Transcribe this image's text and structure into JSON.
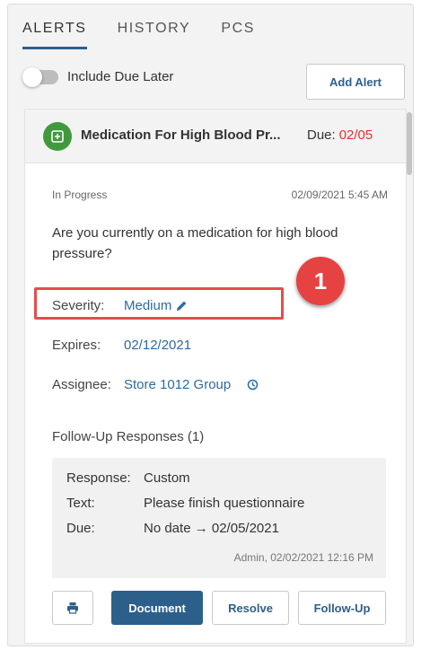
{
  "tabs": [
    {
      "label": "ALERTS",
      "active": true
    },
    {
      "label": "HISTORY",
      "active": false
    },
    {
      "label": "PCS",
      "active": false
    }
  ],
  "controls": {
    "toggle_label": "Include Due Later",
    "toggle_on": false,
    "add_alert_label": "Add Alert"
  },
  "alert": {
    "icon": "medication-icon",
    "title": "Medication For High Blood Pr...",
    "due_label": "Due:",
    "due_date": "02/05",
    "status": "In Progress",
    "timestamp": "02/09/2021 5:45 AM",
    "question": "Are you currently on a medication for high blood pressure?",
    "severity_label": "Severity:",
    "severity_value": "Medium",
    "expires_label": "Expires:",
    "expires_value": "02/12/2021",
    "assignee_label": "Assignee:",
    "assignee_value": "Store 1012 Group"
  },
  "followup": {
    "title": "Follow-Up Responses (1)",
    "response_label": "Response:",
    "response_value": "Custom",
    "text_label": "Text:",
    "text_value": "Please finish questionnaire",
    "due_label": "Due:",
    "due_value": "No date → 02/05/2021",
    "meta": "Admin, 02/02/2021 12:16 PM"
  },
  "actions": {
    "print_icon": "printer-icon",
    "document_label": "Document",
    "resolve_label": "Resolve",
    "followup_label": "Follow-Up"
  },
  "callout": {
    "number": "1"
  },
  "colors": {
    "accent": "#2d5f8b",
    "link": "#2d6aa0",
    "due_red": "#e4302f",
    "callout_red": "#e64242",
    "icon_green": "#3f9a3b"
  }
}
